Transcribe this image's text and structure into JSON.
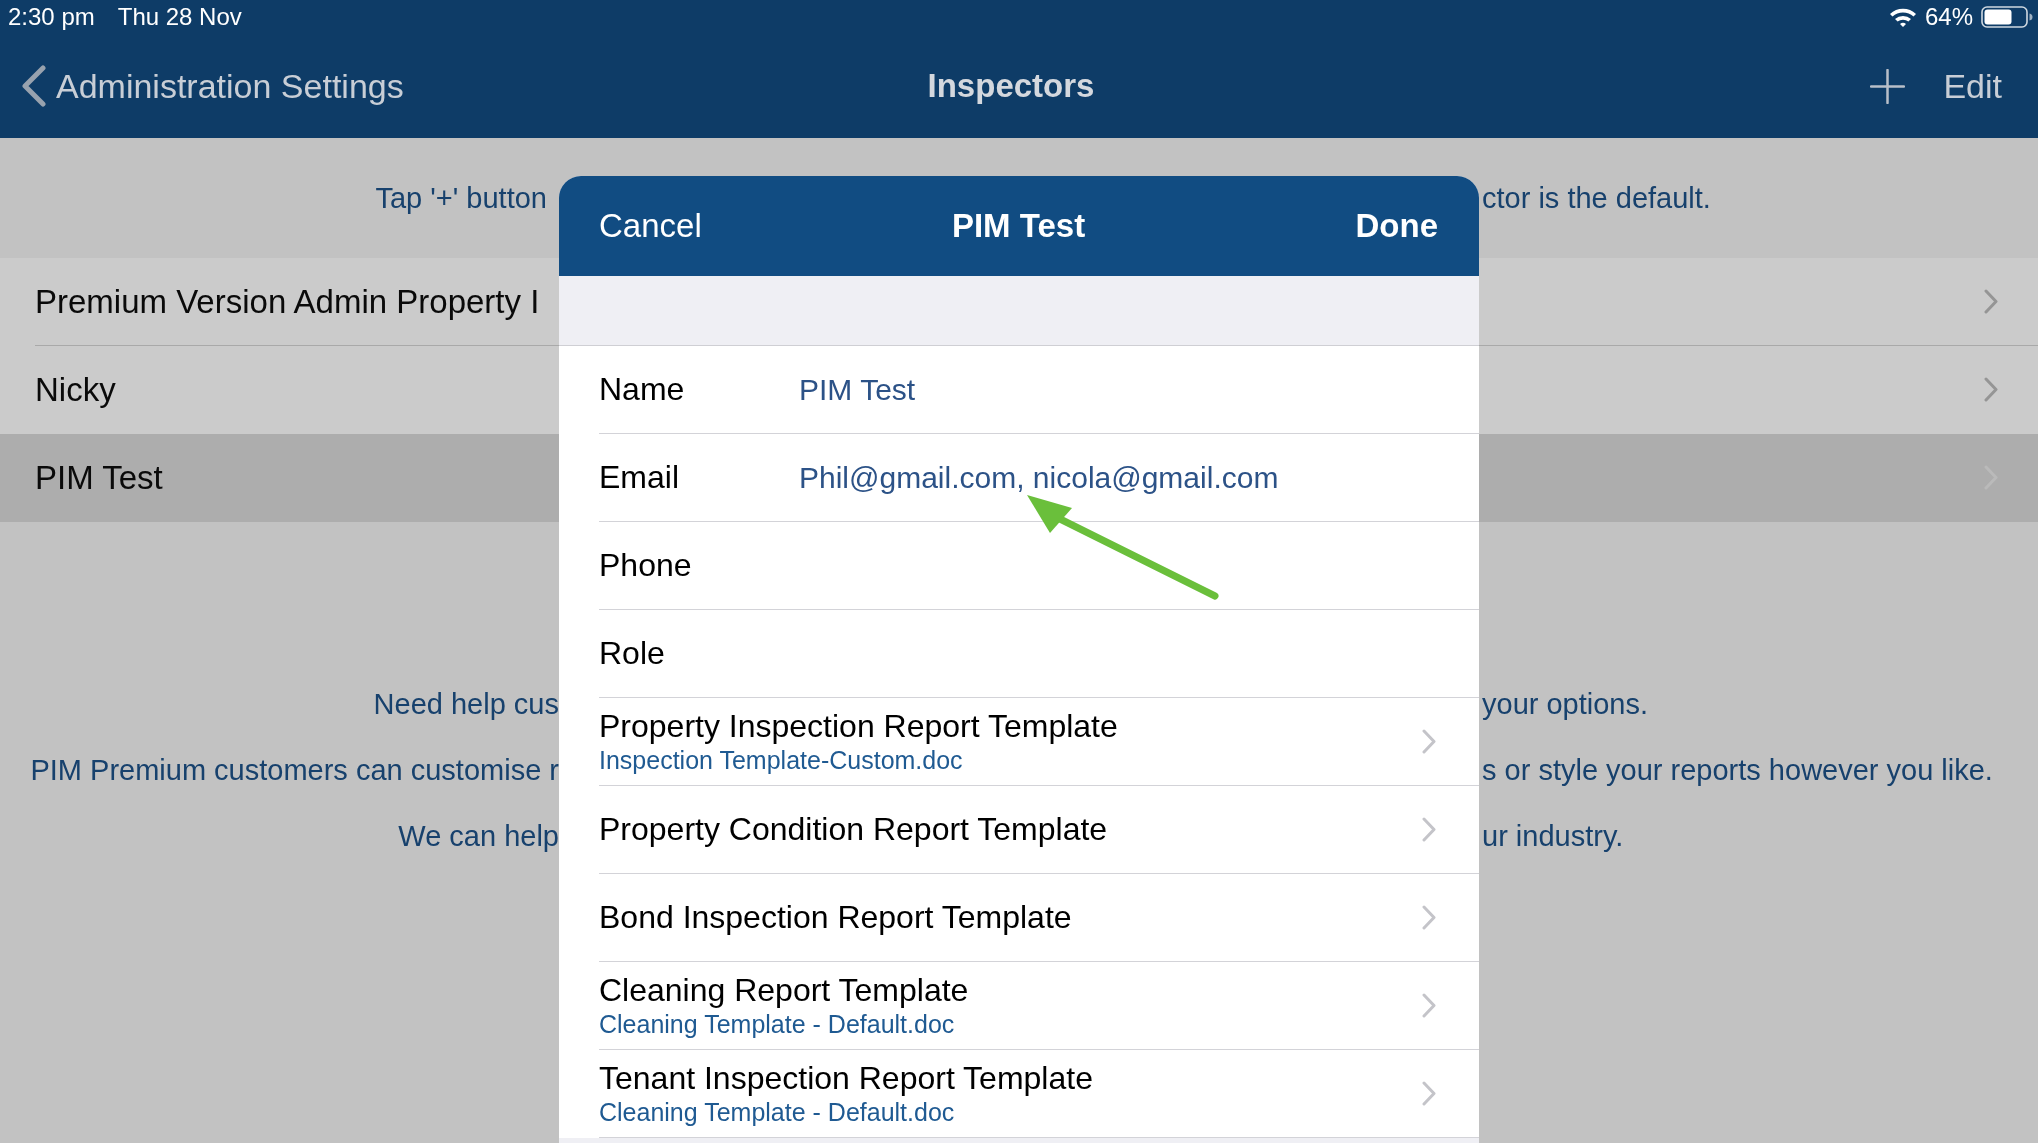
{
  "status_bar": {
    "time": "2:30 pm",
    "date": "Thu 28 Nov",
    "battery": "64%"
  },
  "nav_bar": {
    "back": "Administration Settings",
    "title": "Inspectors",
    "edit": "Edit"
  },
  "hint": {
    "left": "Tap '+' button",
    "right": "ctor is the default."
  },
  "inspectors": [
    {
      "name": "Premium Version Admin Property I",
      "selected": false
    },
    {
      "name": "Nicky",
      "selected": false
    },
    {
      "name": "PIM Test",
      "selected": true
    }
  ],
  "help_lines": [
    {
      "left": "Need help cus",
      "right": "your options."
    },
    {
      "left": "PIM Premium customers can customise r",
      "right": "s or style your reports however you like."
    },
    {
      "left": "We can help",
      "right": "ur industry."
    }
  ],
  "editor": {
    "cancel": "Cancel",
    "title": "PIM Test",
    "done": "Done",
    "fields": [
      {
        "label": "Name",
        "value": "PIM Test"
      },
      {
        "label": "Email",
        "value": "Phil@gmail.com, nicola@gmail.com"
      },
      {
        "label": "Phone"
      },
      {
        "label": "Role"
      }
    ],
    "templates": [
      {
        "title": "Property Inspection Report Template",
        "file": "Inspection Template-Custom.doc"
      },
      {
        "title": "Property Condition Report Template"
      },
      {
        "title": "Bond Inspection Report Template"
      },
      {
        "title": "Cleaning Report Template",
        "file": "Cleaning Template - Default.doc"
      },
      {
        "title": "Tenant Inspection Report Template",
        "file": "Cleaning Template - Default.doc"
      }
    ]
  }
}
